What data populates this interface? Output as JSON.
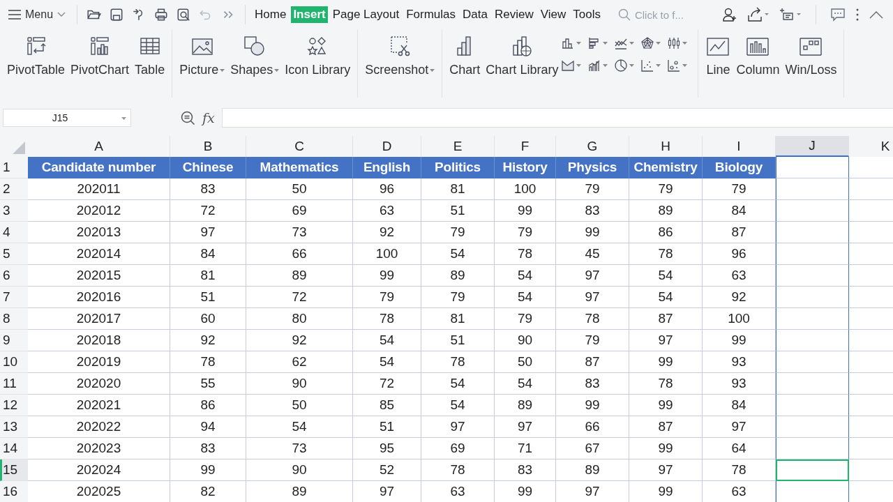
{
  "menu": {
    "label": "Menu"
  },
  "quick_tools": [
    {
      "kind": "open"
    },
    {
      "kind": "save"
    },
    {
      "kind": "format"
    },
    {
      "kind": "print"
    },
    {
      "kind": "preview"
    },
    {
      "kind": "undo",
      "disabled": true
    },
    {
      "kind": "more"
    }
  ],
  "tabs": [
    {
      "label": "Home",
      "selected": false
    },
    {
      "label": "Insert",
      "selected": true
    },
    {
      "label": "Page Layout",
      "selected": false
    },
    {
      "label": "Formulas",
      "selected": false
    },
    {
      "label": "Data",
      "selected": false
    },
    {
      "label": "Review",
      "selected": false
    },
    {
      "label": "View",
      "selected": false
    },
    {
      "label": "Tools",
      "selected": false
    }
  ],
  "search": {
    "placeholder": "Click to f..."
  },
  "ribbon_groups": [
    [
      {
        "kind": "pivottable",
        "label": "PivotTable",
        "caret": false
      },
      {
        "kind": "pivotchart",
        "label": "PivotChart",
        "caret": false
      },
      {
        "kind": "table",
        "label": "Table",
        "caret": false
      }
    ],
    [
      {
        "kind": "picture",
        "label": "Picture",
        "caret": true
      },
      {
        "kind": "shapes",
        "label": "Shapes",
        "caret": true
      },
      {
        "kind": "iconlib",
        "label": "Icon Library",
        "caret": false
      }
    ],
    [
      {
        "kind": "screenshot",
        "label": "Screenshot",
        "caret": true
      }
    ],
    [
      {
        "kind": "chart",
        "label": "Chart",
        "caret": false
      },
      {
        "kind": "chartlib",
        "label": "Chart Library",
        "caret": false
      },
      {
        "kind": "minicharts"
      }
    ],
    [
      {
        "kind": "line",
        "label": "Line",
        "caret": false
      },
      {
        "kind": "column",
        "label": "Column",
        "caret": false
      },
      {
        "kind": "winloss",
        "label": "Win/Loss",
        "caret": false
      }
    ]
  ],
  "name_box": {
    "value": "J15"
  },
  "formula_bar": {
    "function_label": "fx"
  },
  "columns": [
    {
      "letter": "A",
      "selected": false
    },
    {
      "letter": "B",
      "selected": false
    },
    {
      "letter": "C",
      "selected": false
    },
    {
      "letter": "D",
      "selected": false
    },
    {
      "letter": "E",
      "selected": false
    },
    {
      "letter": "F",
      "selected": false
    },
    {
      "letter": "G",
      "selected": false
    },
    {
      "letter": "H",
      "selected": false
    },
    {
      "letter": "I",
      "selected": false
    },
    {
      "letter": "J",
      "selected": true
    },
    {
      "letter": "K",
      "selected": false
    }
  ],
  "header_row": {
    "number": "1",
    "cells": [
      "Candidate number",
      "Chinese",
      "Mathematics",
      "English",
      "Politics",
      "History",
      "Physics",
      "Chemistry",
      "Biology"
    ]
  },
  "rows": [
    {
      "number": "2",
      "selected": false,
      "cells": [
        "202011",
        "83",
        "50",
        "96",
        "81",
        "100",
        "79",
        "79",
        "79"
      ]
    },
    {
      "number": "3",
      "selected": false,
      "cells": [
        "202012",
        "72",
        "69",
        "63",
        "51",
        "99",
        "83",
        "89",
        "84"
      ]
    },
    {
      "number": "4",
      "selected": false,
      "cells": [
        "202013",
        "97",
        "73",
        "92",
        "79",
        "79",
        "99",
        "86",
        "87"
      ]
    },
    {
      "number": "5",
      "selected": false,
      "cells": [
        "202014",
        "84",
        "66",
        "100",
        "54",
        "78",
        "45",
        "78",
        "96"
      ]
    },
    {
      "number": "6",
      "selected": false,
      "cells": [
        "202015",
        "81",
        "89",
        "99",
        "89",
        "54",
        "97",
        "54",
        "63"
      ]
    },
    {
      "number": "7",
      "selected": false,
      "cells": [
        "202016",
        "51",
        "72",
        "79",
        "79",
        "54",
        "97",
        "54",
        "92"
      ]
    },
    {
      "number": "8",
      "selected": false,
      "cells": [
        "202017",
        "60",
        "80",
        "78",
        "81",
        "79",
        "78",
        "87",
        "100"
      ]
    },
    {
      "number": "9",
      "selected": false,
      "cells": [
        "202018",
        "92",
        "92",
        "54",
        "51",
        "90",
        "79",
        "97",
        "99"
      ]
    },
    {
      "number": "10",
      "selected": false,
      "cells": [
        "202019",
        "78",
        "62",
        "54",
        "78",
        "50",
        "87",
        "99",
        "93"
      ]
    },
    {
      "number": "11",
      "selected": false,
      "cells": [
        "202020",
        "55",
        "90",
        "72",
        "54",
        "54",
        "83",
        "78",
        "93"
      ]
    },
    {
      "number": "12",
      "selected": false,
      "cells": [
        "202021",
        "86",
        "50",
        "85",
        "54",
        "89",
        "99",
        "99",
        "84"
      ]
    },
    {
      "number": "13",
      "selected": false,
      "cells": [
        "202022",
        "94",
        "54",
        "51",
        "97",
        "97",
        "66",
        "87",
        "97"
      ]
    },
    {
      "number": "14",
      "selected": false,
      "cells": [
        "202023",
        "83",
        "73",
        "95",
        "69",
        "71",
        "67",
        "99",
        "64"
      ]
    },
    {
      "number": "15",
      "selected": true,
      "cells": [
        "202024",
        "99",
        "90",
        "52",
        "78",
        "83",
        "89",
        "97",
        "78"
      ]
    },
    {
      "number": "16",
      "selected": false,
      "cells": [
        "202025",
        "82",
        "89",
        "97",
        "63",
        "99",
        "97",
        "99",
        "63"
      ]
    }
  ]
}
